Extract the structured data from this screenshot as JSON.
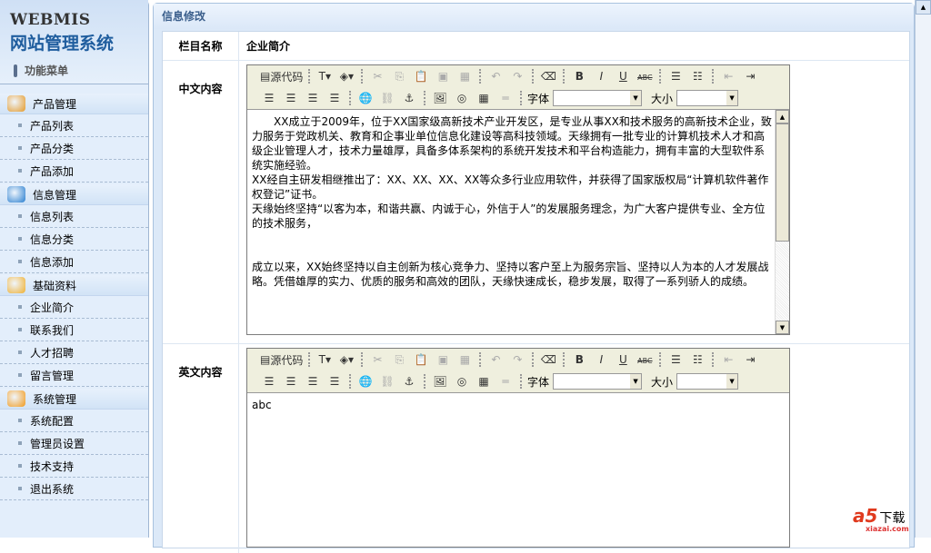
{
  "sidebar": {
    "logo_en": "WEBMIS",
    "logo_cn": "网站管理系统",
    "menu_title": "功能菜单",
    "groups": [
      {
        "label": "产品管理",
        "icon": "product-icon",
        "color": "#e59a2a",
        "items": [
          "产品列表",
          "产品分类",
          "产品添加"
        ]
      },
      {
        "label": "信息管理",
        "icon": "info-icon",
        "color": "#2a7fd0",
        "items": [
          "信息列表",
          "信息分类",
          "信息添加"
        ]
      },
      {
        "label": "基础资料",
        "icon": "folder-icon",
        "color": "#f0b030",
        "items": [
          "企业简介",
          "联系我们",
          "人才招聘",
          "留言管理"
        ]
      },
      {
        "label": "系统管理",
        "icon": "gear-icon",
        "color": "#f29a1b",
        "items": [
          "系统配置",
          "管理员设置",
          "技术支持",
          "退出系统"
        ]
      }
    ]
  },
  "main": {
    "title": "信息修改",
    "field_column_label": "栏目名称",
    "field_column_value": "企业简介",
    "cn_label": "中文内容",
    "en_label": "英文内容"
  },
  "editor": {
    "source_label": "源代码",
    "font_label": "字体",
    "size_label": "大小"
  },
  "cn_content": [
    "　　XX成立于2009年，位于XX国家级高新技术产业开发区，是专业从事XX和技术服务的高新技术企业，致力服务于党政机关、教育和企事业单位信息化建设等高科技领域。天缘拥有一批专业的计算机技术人才和高级企业管理人才，技术力量雄厚，具备多体系架构的系统开发技术和平台构造能力，拥有丰富的大型软件系统实施经验。",
    "XX经自主研发相继推出了：XX、XX、XX、XX等众多行业应用软件，并获得了国家版权局“计算机软件著作权登记”证书。",
    "天缘始终坚持“以客为本，和谐共赢、内诚于心，外信于人”的发展服务理念，为广大客户提供专业、全方位的技术服务，",
    "",
    "",
    "成立以来，XX始终坚持以自主创新为核心竞争力、坚持以客户至上为服务宗旨、坚持以人为本的人才发展战略。凭借雄厚的实力、优质的服务和高效的团队，天缘快速成长，稳步发展，取得了一系列骄人的成绩。"
  ],
  "en_content": "abc",
  "watermark": {
    "brand": "a5",
    "text": "下载",
    "url": "xiazai.com"
  }
}
